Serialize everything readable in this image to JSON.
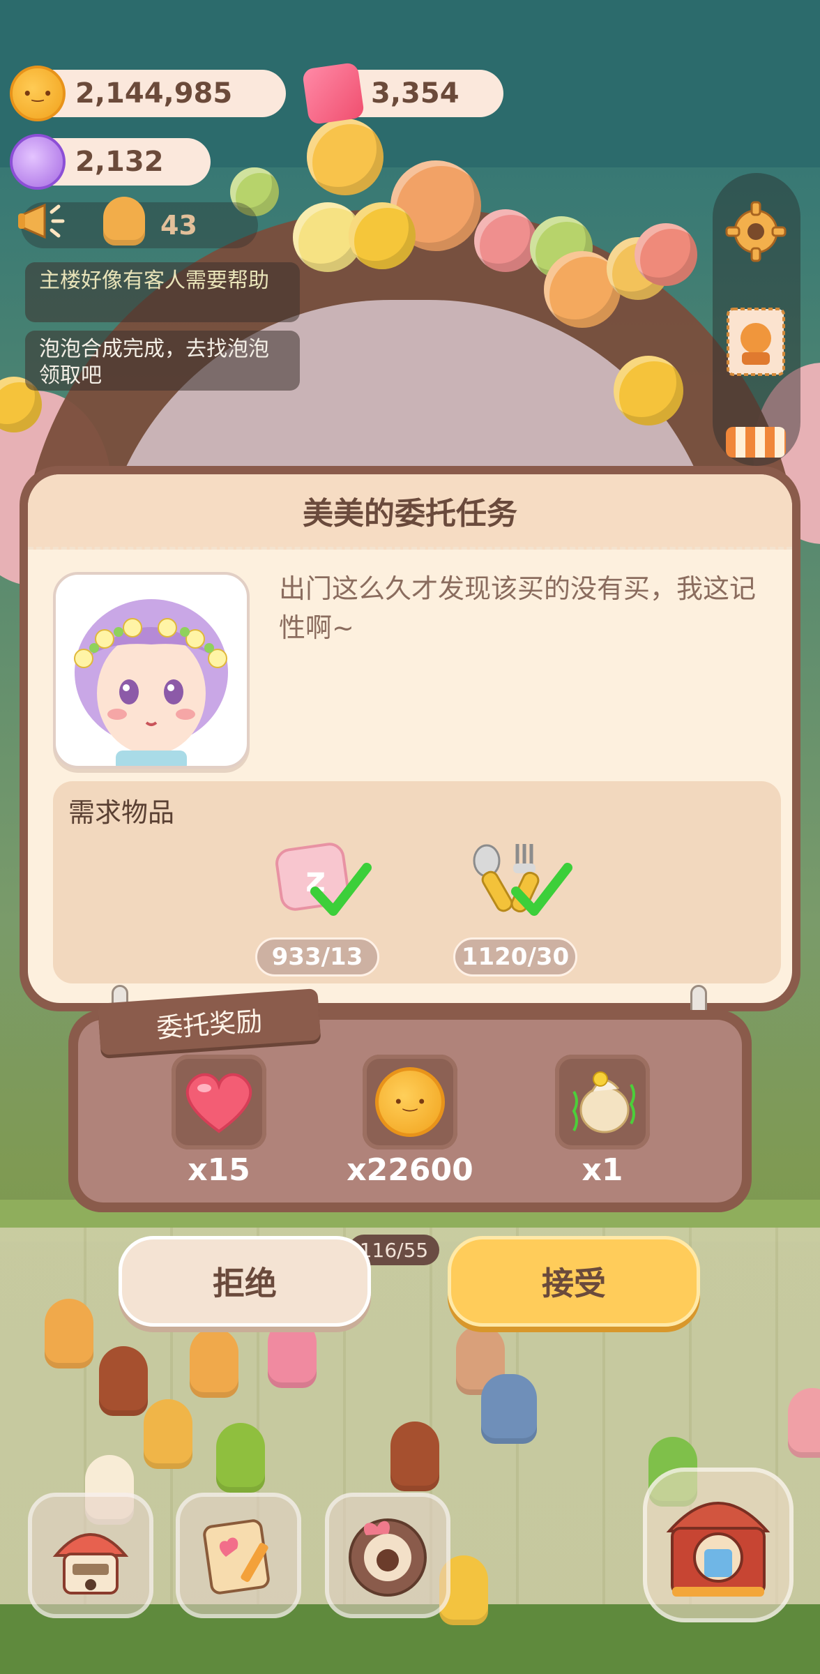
{
  "hud": {
    "cookies": "2,144,985",
    "gems": "3,354",
    "candy": "2,132",
    "speaker_count": "43",
    "notices": [
      "主楼好像有客人需要帮助",
      "泡泡合成完成，去找泡泡领取吧"
    ]
  },
  "dialog": {
    "title": "美美的委托任务",
    "quote": "出门这么久才发现该买的没有买，我这记性啊~",
    "needs_title": "需求物品",
    "needs": [
      {
        "icon": "pillow-icon",
        "count": "933/13"
      },
      {
        "icon": "cutlery-icon",
        "count": "1120/30"
      }
    ]
  },
  "rewards": {
    "tag": "委托奖励",
    "items": [
      {
        "icon": "heart-icon",
        "qty": "x15"
      },
      {
        "icon": "cookie-icon",
        "qty": "x22600"
      },
      {
        "icon": "dragon-egg-icon",
        "qty": "x1"
      }
    ]
  },
  "buttons": {
    "reject": "拒绝",
    "accept": "接受"
  },
  "scene": {
    "progress": "116/55"
  },
  "colors": {
    "panel_brown": "#8a5b4b",
    "panel_cream": "#fdf0de",
    "accept_yellow": "#ffcc5a",
    "check_green": "#3ccf3a"
  }
}
